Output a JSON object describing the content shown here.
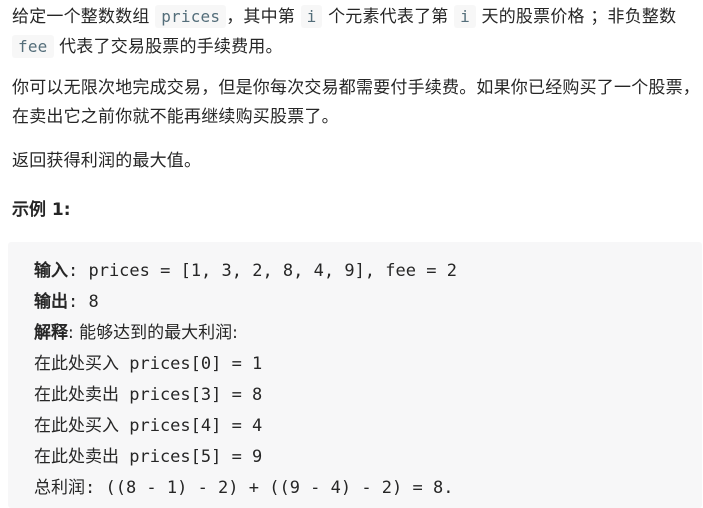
{
  "paragraphs": {
    "p1_part1": "给定一个整数数组 ",
    "p1_code1": "prices",
    "p1_part2": "，其中第 ",
    "p1_code2": "i",
    "p1_part3": " 个元素代表了第 ",
    "p1_code3": "i",
    "p1_part4": " 天的股票价格 ；非负整数 ",
    "p1_code4": "fee",
    "p1_part5": " 代表了交易股票的手续费用。",
    "p2": "你可以无限次地完成交易，但是你每次交易都需要付手续费。如果你已经购买了一个股票，在卖出它之前你就不能再继续购买股票了。",
    "p3": "返回获得利润的最大值。"
  },
  "example": {
    "title": "示例 1:",
    "input_label": "输入",
    "input_value": ": prices = [1, 3, 2, 8, 4, 9], fee = 2",
    "output_label": "输出",
    "output_value": ": 8",
    "explain_label": "解释",
    "explain_value": ": 能够达到的最大利润:",
    "steps": [
      {
        "text": "在此处买入",
        "code": " prices[0] = 1"
      },
      {
        "text": "在此处卖出",
        "code": " prices[3] = 8"
      },
      {
        "text": "在此处买入",
        "code": " prices[4] = 4"
      },
      {
        "text": "在此处卖出",
        "code": " prices[5] = 9"
      }
    ],
    "total_label": "总利润",
    "total_value": ": ((8 - 1) - 2) + ((9 - 4) - 2) = 8."
  }
}
